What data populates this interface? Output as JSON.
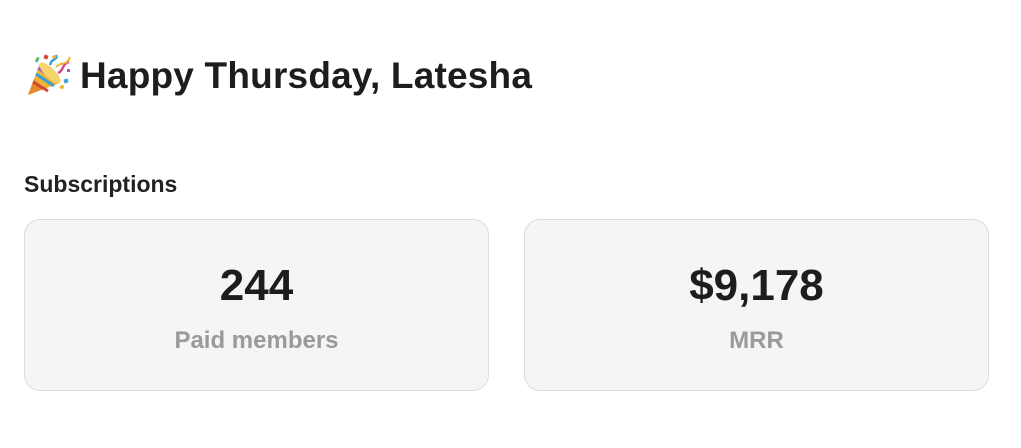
{
  "header": {
    "greeting": "Happy Thursday, Latesha",
    "icon": "party-popper-icon"
  },
  "subscriptions": {
    "title": "Subscriptions",
    "cards": [
      {
        "value": "244",
        "label": "Paid members"
      },
      {
        "value": "$9,178",
        "label": "MRR"
      }
    ]
  }
}
